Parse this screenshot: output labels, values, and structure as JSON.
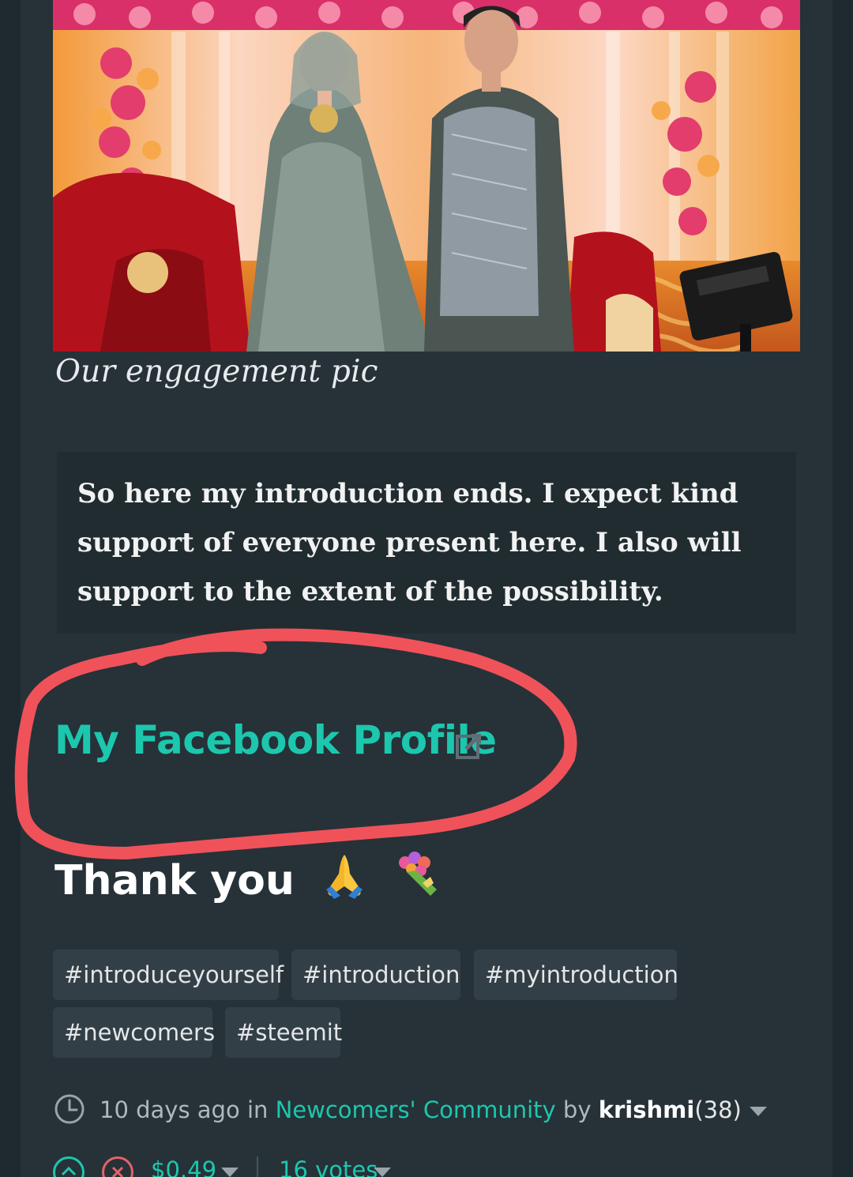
{
  "post": {
    "image_caption": "Our engagement pic",
    "blockquote": "So here my introduction ends. I expect kind support of everyone present here. I also will support to the extent of the possibility.",
    "facebook_link_label": "My Facebook Profile",
    "thanks_text": "Thank you",
    "emojis": [
      "folded-hands",
      "bouquet"
    ]
  },
  "tags": [
    "#introduceyourself",
    "#introduction",
    "#myintroduction",
    "#newcomers",
    "#steemit"
  ],
  "meta": {
    "time_ago": "10 days ago",
    "in_word": "in",
    "community": "Newcomers' Community",
    "by_word": "by",
    "author": "krishmi",
    "reputation": "(38)"
  },
  "voting": {
    "payout": "$0.49",
    "votes": "16 votes"
  },
  "colors": {
    "accent": "#1cc7ae",
    "annotation": "#f0525a",
    "background": "#263238"
  }
}
